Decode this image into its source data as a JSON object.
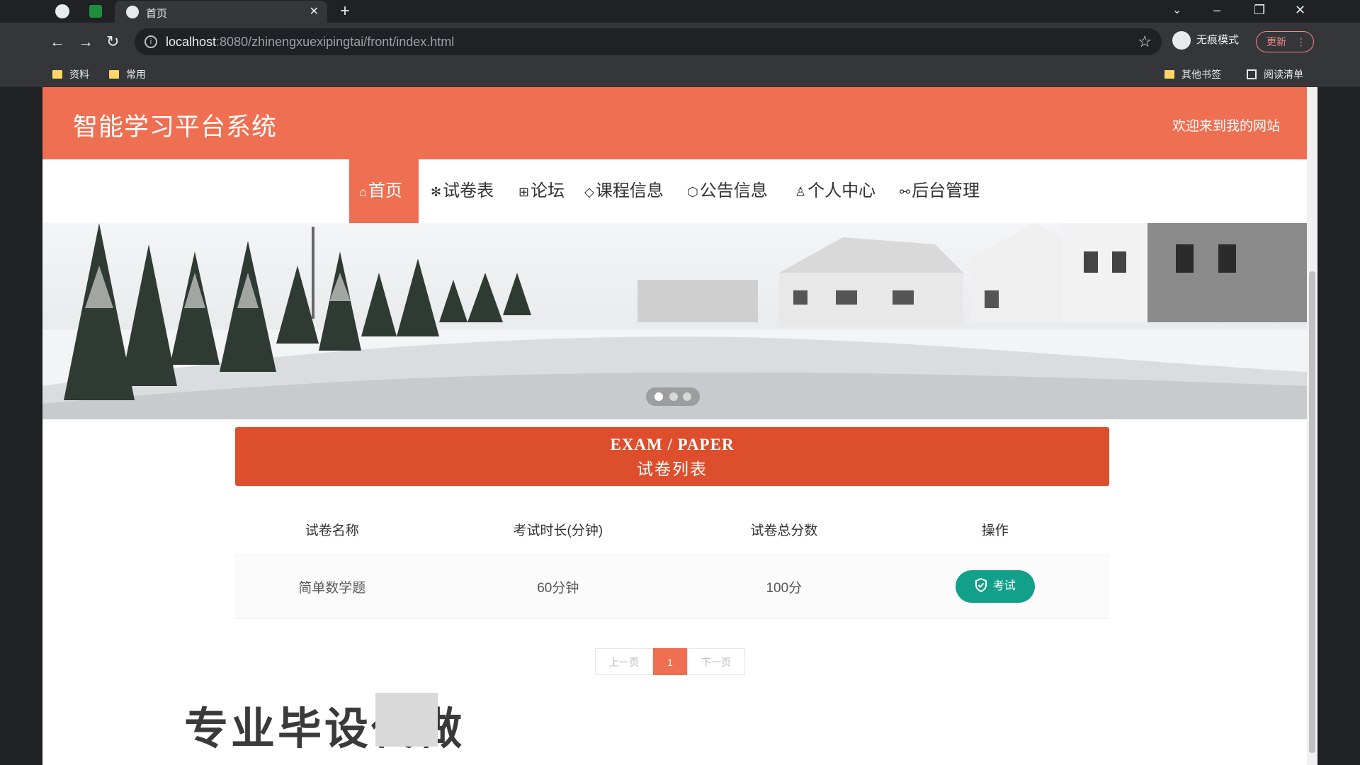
{
  "browser": {
    "tab_title": "首页",
    "url_host": "localhost",
    "url_rest": ":8080/zhinengxuexipingtai/front/index.html",
    "incognito_label": "无痕模式",
    "update_label": "更新",
    "bookmarks": [
      "资料",
      "常用"
    ],
    "other_bookmarks": "其他书签",
    "reading_list": "阅读清单"
  },
  "site": {
    "title": "智能学习平台系统",
    "welcome": "欢迎来到我的网站",
    "accent_color": "#ee6f51"
  },
  "nav": [
    {
      "icon": "home-icon",
      "label": "首页",
      "active": true
    },
    {
      "icon": "snowflake-icon",
      "label": "试卷表",
      "active": false
    },
    {
      "icon": "grid-icon",
      "label": "论坛",
      "active": false
    },
    {
      "icon": "tag-icon",
      "label": "课程信息",
      "active": false
    },
    {
      "icon": "cube-icon",
      "label": "公告信息",
      "active": false
    },
    {
      "icon": "user-icon",
      "label": "个人中心",
      "active": false
    },
    {
      "icon": "link-icon",
      "label": "后台管理",
      "active": false
    }
  ],
  "carousel": {
    "slide_count": 3,
    "active_index": 0
  },
  "section": {
    "en": "EXAM / PAPER",
    "zh": "试卷列表"
  },
  "table": {
    "headers": [
      "试卷名称",
      "考试时长(分钟)",
      "试卷总分数",
      "操作"
    ],
    "rows": [
      {
        "name": "简单数学题",
        "duration": "60分钟",
        "score": "100分",
        "action": "考试"
      }
    ]
  },
  "pagination": {
    "prev": "上一页",
    "current": "1",
    "next": "下一页"
  },
  "overlay_text": "专业毕设代做"
}
